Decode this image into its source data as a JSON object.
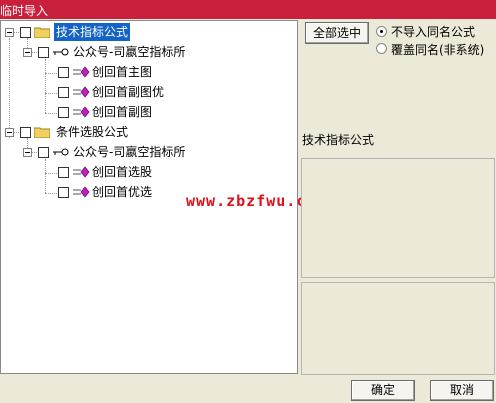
{
  "window": {
    "title": "临时导入"
  },
  "tree": {
    "groups": [
      {
        "label": "技术指标公式",
        "child": "公众号-司嬴空指标所",
        "items": [
          "创回首主图",
          "创回首副图优",
          "创回首副图"
        ]
      },
      {
        "label": "条件选股公式",
        "child": "公众号-司嬴空指标所",
        "items": [
          "创回首选股",
          "创回首优选"
        ]
      }
    ]
  },
  "options": {
    "select_all_label": "全部选中",
    "radio1": "不导入同名公式",
    "radio2": "覆盖同名(非系统)"
  },
  "info": {
    "title": "技术指标公式"
  },
  "watermark": "www.zbzfwu.com",
  "buttons": {
    "ok": "确定",
    "cancel": "取消"
  },
  "colors": {
    "titlebar": "#c8203c",
    "selection": "#1464c8",
    "watermark": "#e0101a"
  }
}
